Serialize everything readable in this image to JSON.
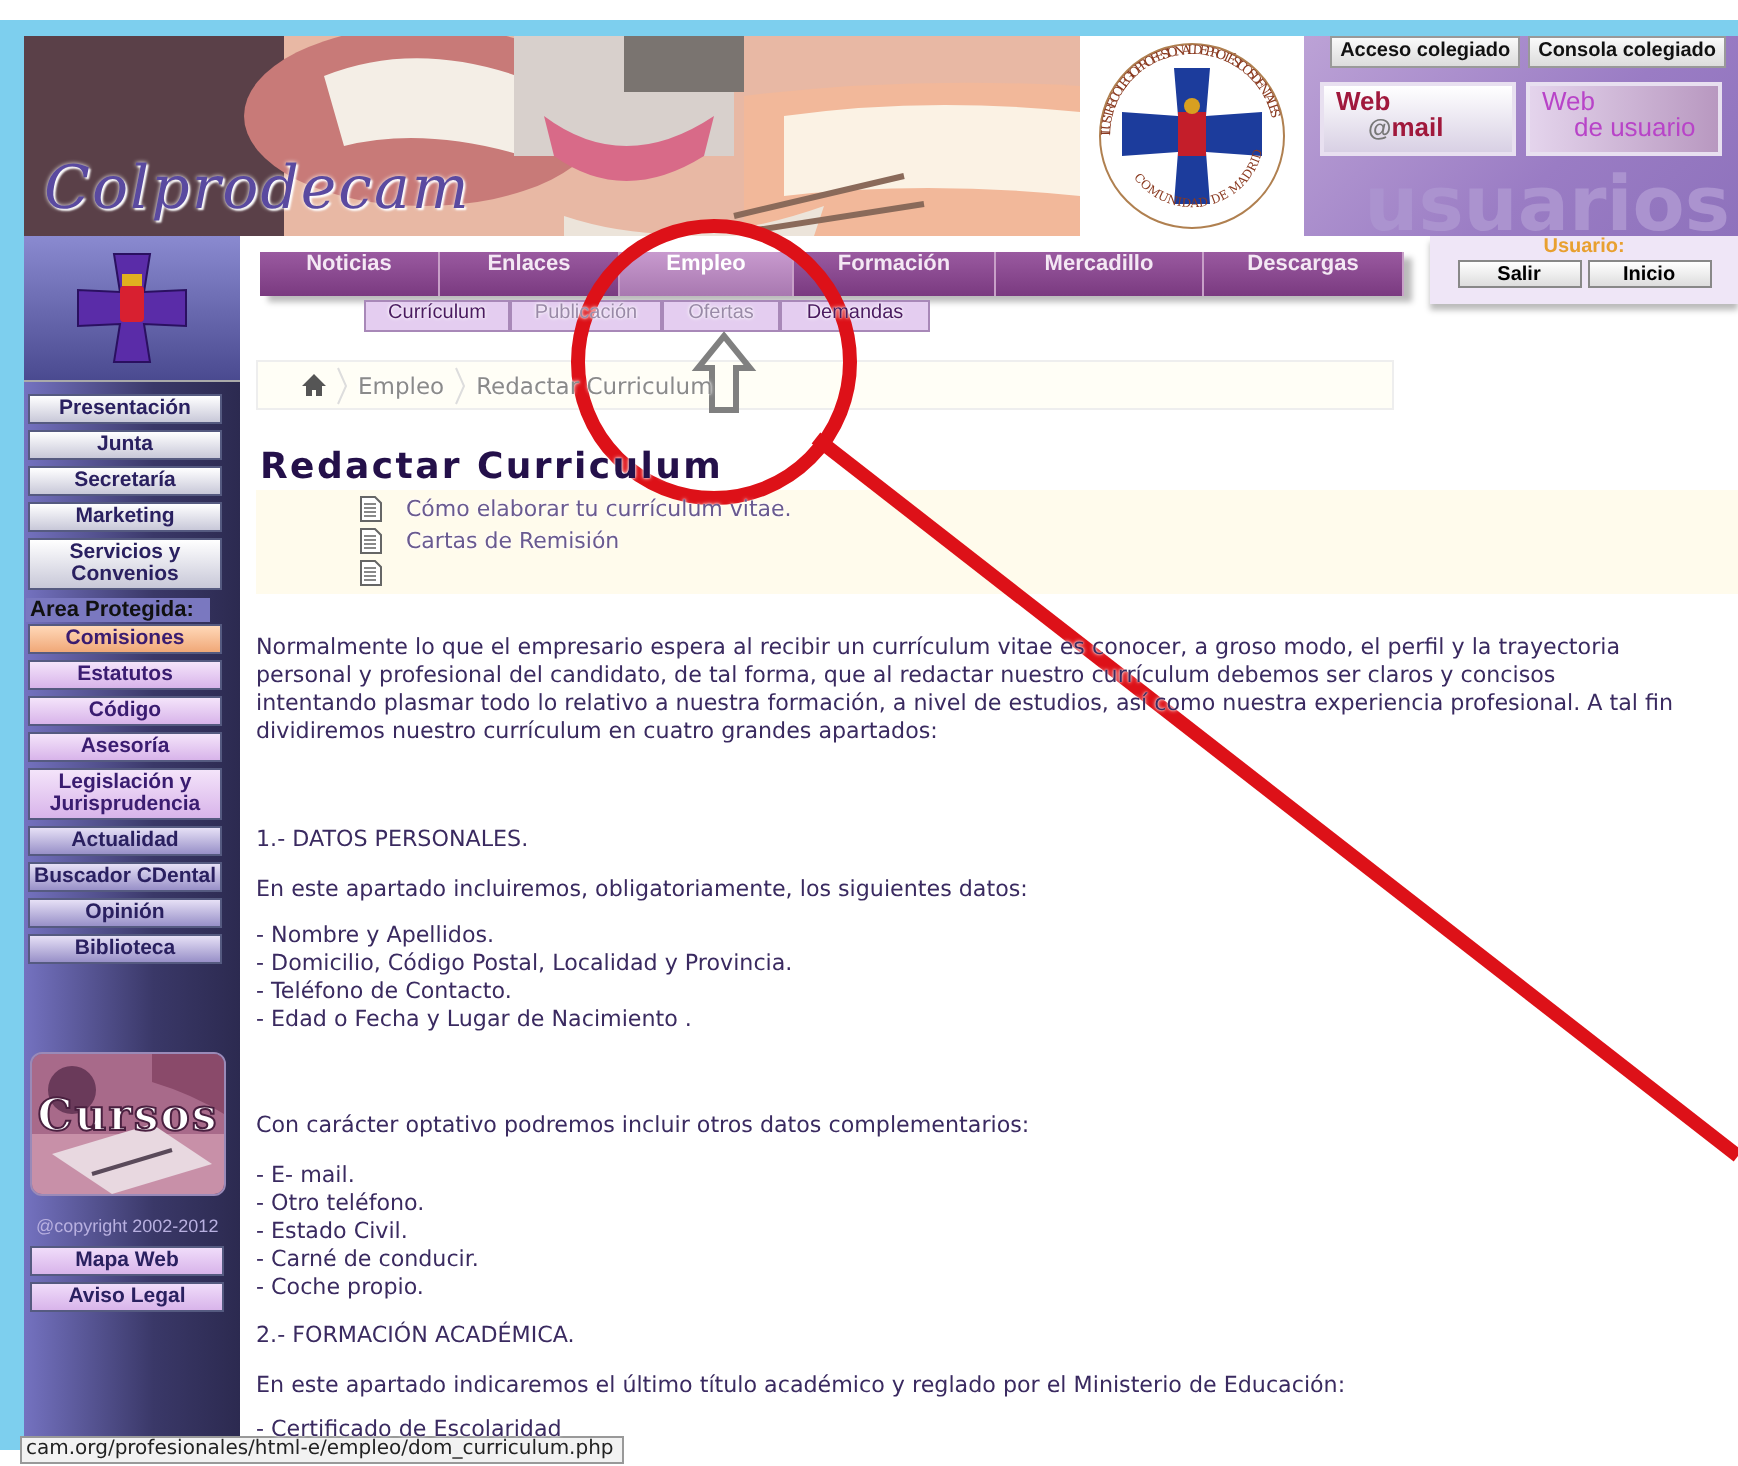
{
  "header": {
    "site_name": "Colprodecam",
    "seal_top": "ILUSTRE COLEGIO PROFESIONAL DE PROTÉSICOS DENTALES",
    "seal_bottom": "COMUNIDAD DE MADRID",
    "top_links": [
      "Acceso colegiado",
      "Consola colegiado"
    ],
    "image_buttons": [
      {
        "top": "Web",
        "symbol": "@",
        "bottom": "mail"
      },
      {
        "top": "Web",
        "bottom": "de usuario"
      }
    ],
    "backdrop_word": "usuarios"
  },
  "nav": {
    "tabs": [
      {
        "label": "Noticias",
        "selected": false
      },
      {
        "label": "Enlaces",
        "selected": false
      },
      {
        "label": "Empleo",
        "selected": true
      },
      {
        "label": "Formación",
        "selected": false
      },
      {
        "label": "Mercadillo",
        "selected": false
      },
      {
        "label": "Descargas",
        "selected": false
      }
    ],
    "subtabs": [
      {
        "label": "Currículum",
        "visited": false
      },
      {
        "label": "Publicación",
        "visited": true
      },
      {
        "label": "Ofertas",
        "visited": true
      },
      {
        "label": "Demandas",
        "visited": false
      }
    ]
  },
  "user_box": {
    "label": "Usuario:",
    "buttons": [
      "Salir",
      "Inicio"
    ]
  },
  "sidebar": {
    "items": [
      {
        "label": "Presentación",
        "selected": false
      },
      {
        "label": "Junta",
        "selected": false
      },
      {
        "label": "Secretaría",
        "selected": false
      },
      {
        "label": "Marketing",
        "selected": false
      },
      {
        "label": "Servicios  y Convenios",
        "selected": false
      }
    ],
    "protected_label": "Area Protegida:",
    "protected_items": [
      {
        "label": "Comisiones",
        "kind": "restricted",
        "selected": true
      },
      {
        "label": "Estatutos",
        "kind": "restricted",
        "selected": false
      },
      {
        "label": "Código",
        "kind": "restricted",
        "selected": false
      },
      {
        "label": "Asesoría",
        "kind": "restricted",
        "selected": false
      },
      {
        "label": "Legislación y Jurisprudencia",
        "kind": "restricted",
        "selected": false
      },
      {
        "label": "Actualidad",
        "kind": "general",
        "selected": false
      },
      {
        "label": "Buscador CDental",
        "kind": "general",
        "selected": false
      },
      {
        "label": "Opinión",
        "kind": "general",
        "selected": false
      },
      {
        "label": "Biblioteca",
        "kind": "general",
        "selected": false
      }
    ],
    "courses_label": "Cursos",
    "copyright": "@copyright 2002-2012",
    "footer_links": [
      "Mapa Web",
      "Aviso Legal"
    ]
  },
  "breadcrumb": [
    "Empleo",
    "Redactar Curriculum"
  ],
  "page": {
    "title": "Redactar Curriculum",
    "doc_links": [
      "Cómo elaborar tu currículum vitae.",
      "Cartas de Remisión"
    ],
    "blocks": [
      {
        "kind": "paragraph",
        "text": "Normalmente lo que el empresario espera al recibir un currículum vitae es conocer, a groso modo, el perfil y la trayectoria personal y profesional del candidato, de tal forma, que al redactar nuestro currículum debemos ser claros y concisos intentando plasmar todo lo relativo a nuestra formación, a nivel de estudios, así como nuestra experiencia profesional. A tal fin dividiremos nuestro currículum en cuatro grandes apartados:"
      },
      {
        "kind": "paragraph",
        "text": "1.- DATOS PERSONALES."
      },
      {
        "kind": "paragraph",
        "text": "En este apartado incluiremos, obligatoriamente, los siguientes datos:"
      },
      {
        "kind": "list",
        "items": [
          "- Nombre y Apellidos.",
          "- Domicilio, Código Postal, Localidad y Provincia.",
          "- Teléfono de Contacto.",
          "- Edad o Fecha y Lugar de Nacimiento ."
        ]
      },
      {
        "kind": "paragraph",
        "text": "Con carácter optativo podremos incluir otros datos complementarios:"
      },
      {
        "kind": "list",
        "items": [
          "- E- mail.",
          "- Otro teléfono.",
          "- Estado Civil.",
          "- Carné de conducir.",
          "- Coche propio."
        ]
      },
      {
        "kind": "paragraph",
        "text": "2.- FORMACIÓN ACADÉMICA."
      },
      {
        "kind": "paragraph",
        "text": "En este apartado indicaremos el último título académico y reglado por el Ministerio de Educación:"
      },
      {
        "kind": "list",
        "items": [
          "- Certificado de Escolaridad"
        ]
      }
    ]
  },
  "status_url": "cam.org/profesionales/html-e/empleo/dom_curriculum.php"
}
